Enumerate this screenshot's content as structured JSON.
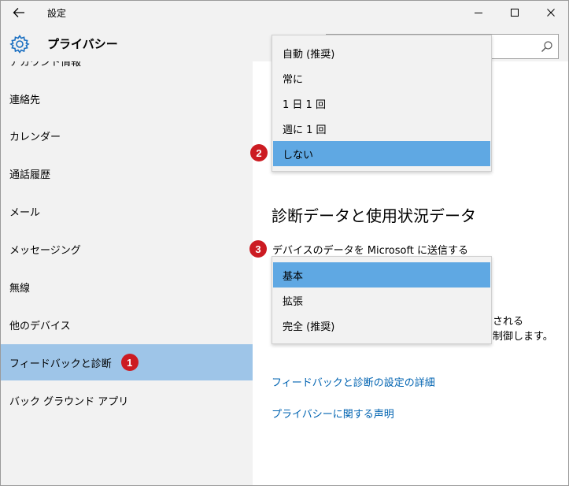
{
  "titlebar": {
    "title": "設定",
    "back_icon": "arrow-left-icon",
    "controls": [
      "minimize-icon",
      "maximize-icon",
      "close-icon"
    ]
  },
  "header": {
    "title": "プライバシー",
    "icon": "gear-icon",
    "search_value": "",
    "search_icon": "search-icon"
  },
  "sidebar": {
    "cut_item": "アカウント情報",
    "items": [
      {
        "label": "連絡先"
      },
      {
        "label": "カレンダー"
      },
      {
        "label": "通話履歴"
      },
      {
        "label": "メール"
      },
      {
        "label": "メッセージング"
      },
      {
        "label": "無線"
      },
      {
        "label": "他のデバイス"
      },
      {
        "label": "フィードバックと診断",
        "selected": true,
        "badge": "1"
      },
      {
        "label": "バック グラウンド アプリ"
      }
    ]
  },
  "feedback_dropdown": {
    "badge": "2",
    "options": [
      "自動 (推奨)",
      "常に",
      "1 日 1 回",
      "週に 1 回",
      "しない"
    ],
    "selected_index": 4
  },
  "diagnostics": {
    "heading": "診断データと使用状況データ",
    "label": "デバイスのデータを Microsoft に送信する",
    "badge": "3",
    "options": [
      "基本",
      "拡張",
      "完全 (推奨)"
    ],
    "selected_index": 0,
    "trail_line1": "される",
    "trail_line2": "制御します。"
  },
  "links": {
    "details": "フィードバックと診断の設定の詳細",
    "privacy": "プライバシーに関する声明"
  },
  "colors": {
    "sidebar_bg": "#f2f2f2",
    "sidebar_selected": "#9ec5e8",
    "dropdown_selected": "#5fa8e3",
    "badge": "#cc1b22",
    "link": "#0063b1"
  }
}
